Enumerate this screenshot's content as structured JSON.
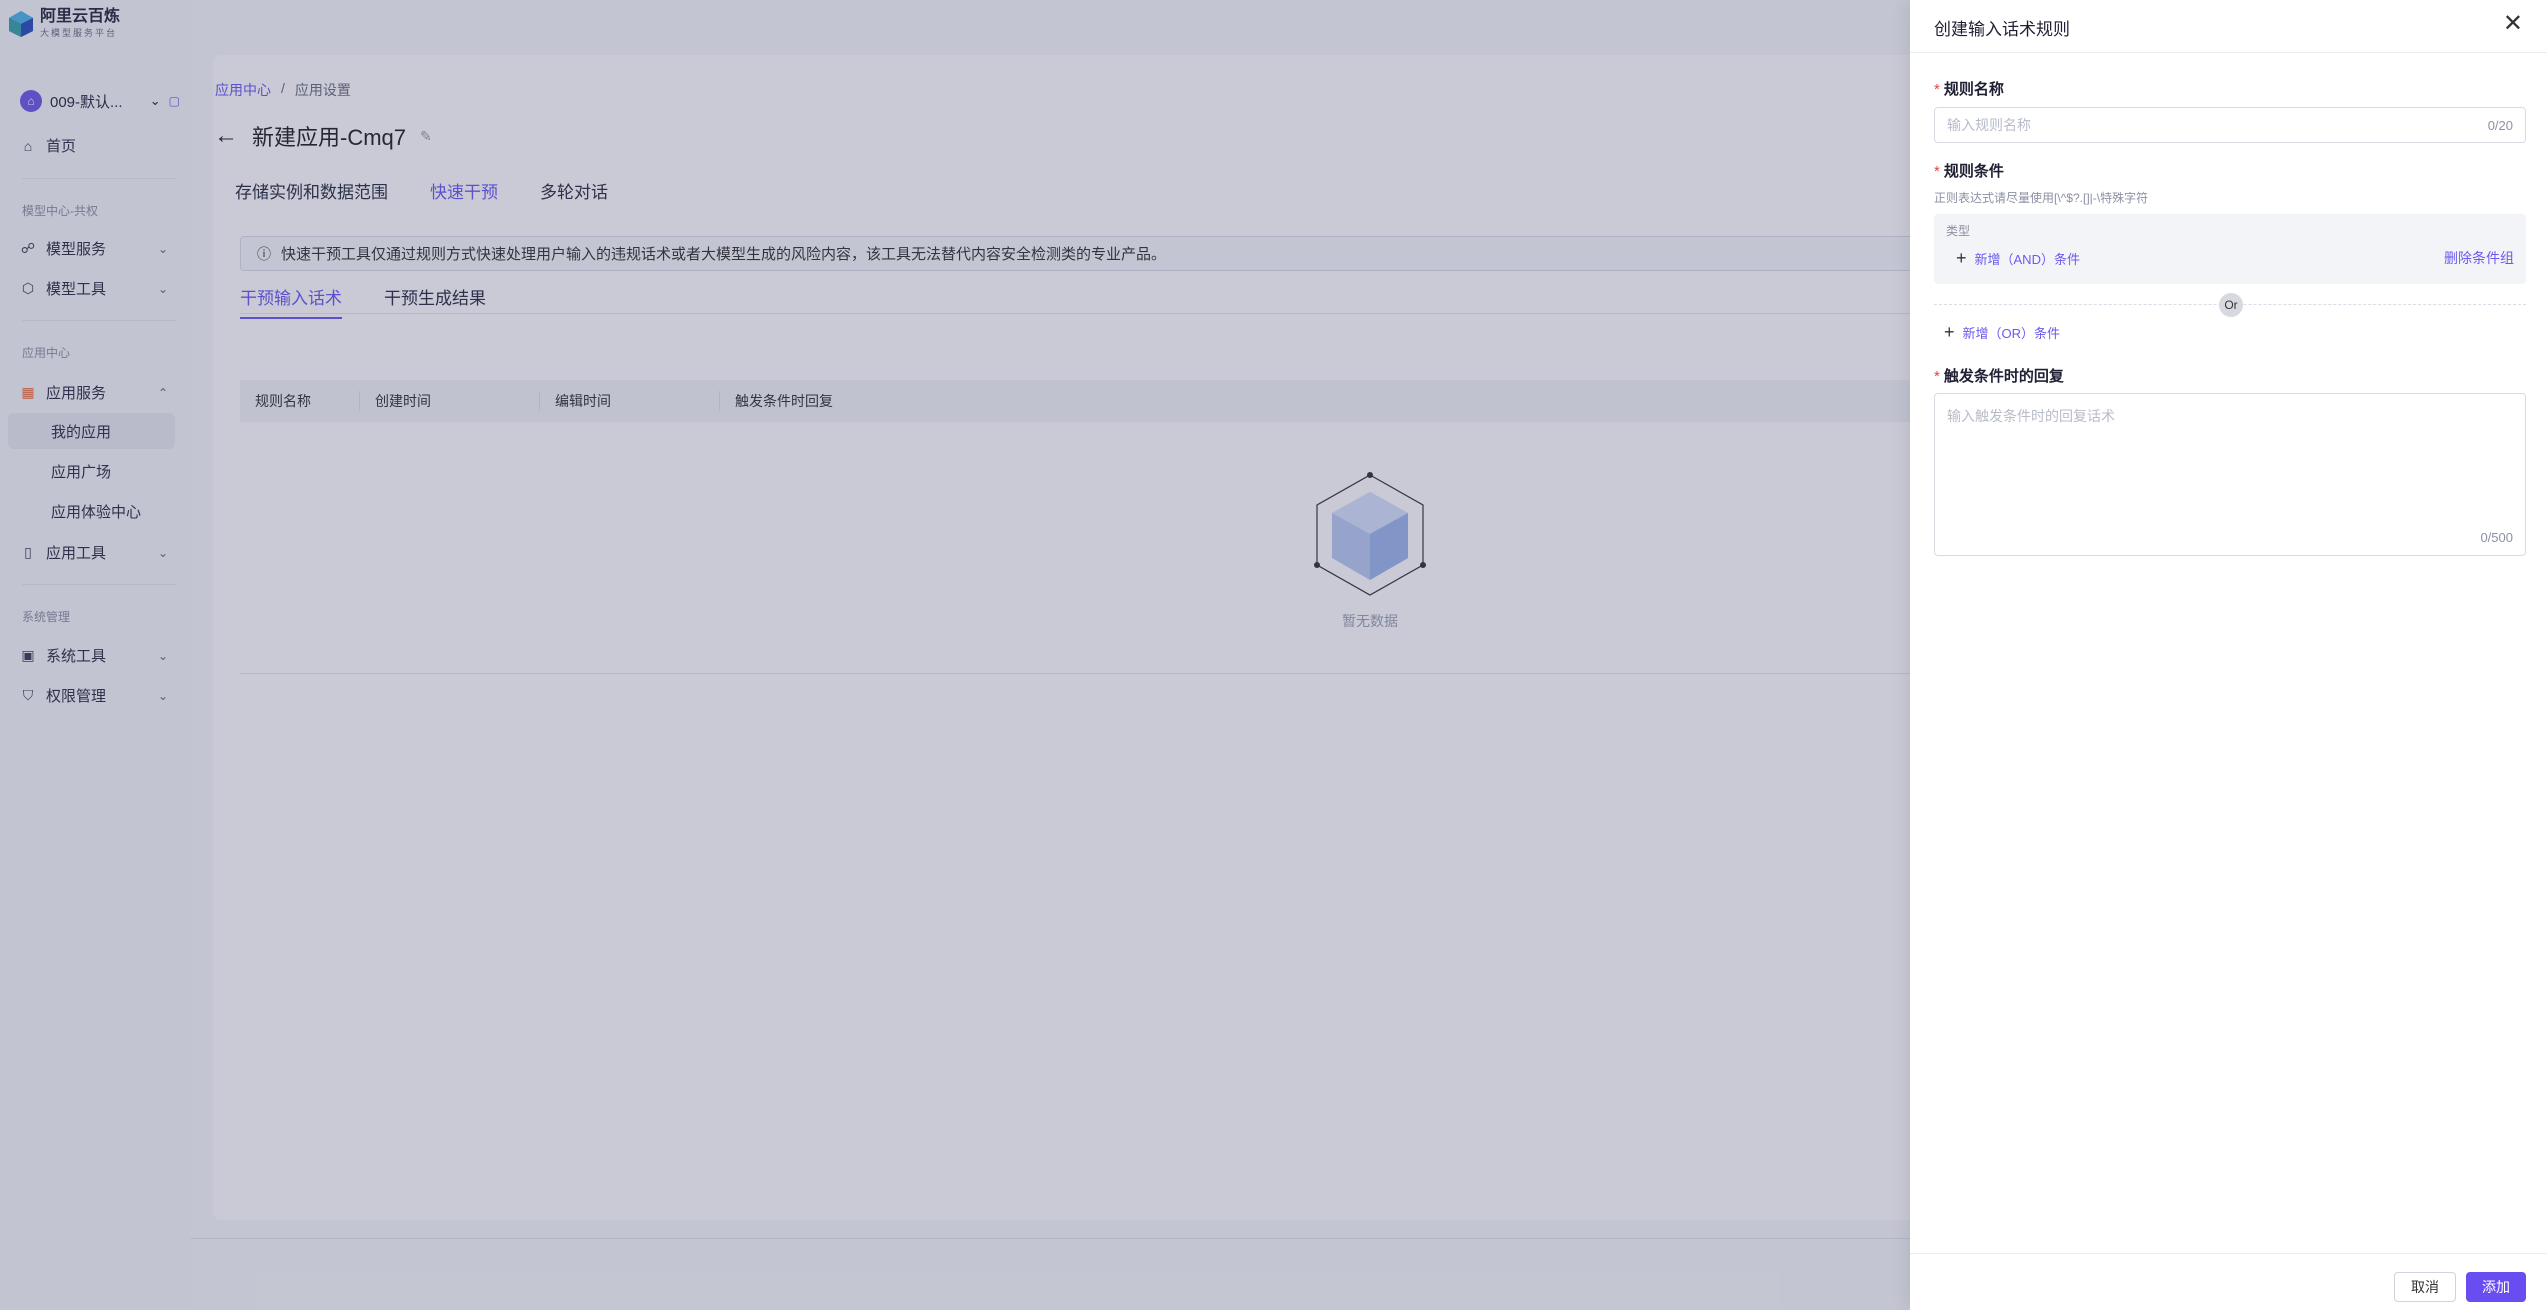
{
  "sidebar": {
    "logo_title": "阿里云百炼",
    "logo_subtitle": "大模型服务平台",
    "workspace": "009-默认...",
    "home": "首页",
    "section_model": "模型中心-共权",
    "model_service": "模型服务",
    "model_tools": "模型工具",
    "section_app": "应用中心",
    "app_service": "应用服务",
    "my_apps": "我的应用",
    "app_plaza": "应用广场",
    "app_experience": "应用体验中心",
    "app_tools": "应用工具",
    "section_system": "系统管理",
    "system_tools": "系统工具",
    "permission": "权限管理"
  },
  "main": {
    "breadcrumb_root": "应用中心",
    "breadcrumb_sep": "/",
    "breadcrumb_current": "应用设置",
    "title": "新建应用-Cmq7",
    "tabs": [
      "存储实例和数据范围",
      "快速干预",
      "多轮对话"
    ],
    "notice": "快速干预工具仅通过规则方式快速处理用户输入的违规话术或者大模型生成的风险内容，该工具无法替代内容安全检测类的专业产品。",
    "subtabs": [
      "干预输入话术",
      "干预生成结果"
    ],
    "columns": [
      "规则名称",
      "创建时间",
      "编辑时间",
      "触发条件时回复"
    ],
    "empty_text": "暂无数据"
  },
  "drawer": {
    "title": "创建输入话术规则",
    "rule_name_label": "规则名称",
    "rule_name_placeholder": "输入规则名称",
    "rule_name_counter": "0/20",
    "condition_label": "规则条件",
    "condition_hint": "正则表达式请尽量使用[\\^$?.[]|-\\特殊字符",
    "type_label": "类型",
    "add_and": "新增（AND）条件",
    "delete_group": "删除条件组",
    "or_badge": "Or",
    "add_or": "新增（OR）条件",
    "reply_label": "触发条件时的回复",
    "reply_placeholder": "输入触发条件时的回复话术",
    "reply_counter": "0/500",
    "cancel": "取消",
    "submit": "添加"
  },
  "colors": {
    "accent": "#6a5af0",
    "primary_button": "#6a4df0",
    "required": "#e54545"
  }
}
